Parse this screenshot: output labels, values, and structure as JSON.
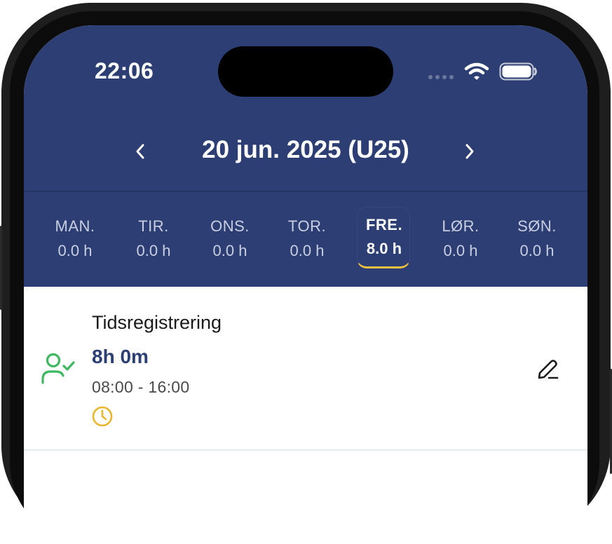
{
  "status_bar": {
    "time": "22:06",
    "icons": [
      "signal-dots-icon",
      "wifi-icon",
      "battery-icon"
    ]
  },
  "date_nav": {
    "prev_icon": "chevron-left-icon",
    "title": "20 jun. 2025 (U25)",
    "next_icon": "chevron-right-icon"
  },
  "week": [
    {
      "day": "MAN.",
      "hours": "0.0 h",
      "active": false
    },
    {
      "day": "TIR.",
      "hours": "0.0 h",
      "active": false
    },
    {
      "day": "ONS.",
      "hours": "0.0 h",
      "active": false
    },
    {
      "day": "TOR.",
      "hours": "0.0 h",
      "active": false
    },
    {
      "day": "FRE.",
      "hours": "8.0 h",
      "active": true
    },
    {
      "day": "LØR.",
      "hours": "0.0 h",
      "active": false
    },
    {
      "day": "SØN.",
      "hours": "0.0 h",
      "active": false
    }
  ],
  "entries": [
    {
      "title": "Tidsregistrering",
      "duration": "8h 0m",
      "range": "08:00 - 16:00",
      "status_icon": "user-check-icon",
      "type_icon": "clock-icon",
      "action_icon": "edit-pencil-icon"
    }
  ],
  "colors": {
    "header_bg": "#2c3e73",
    "accent_underline": "#f0c23f",
    "approved_green": "#3fb861",
    "clock_yellow": "#e8b72e"
  }
}
